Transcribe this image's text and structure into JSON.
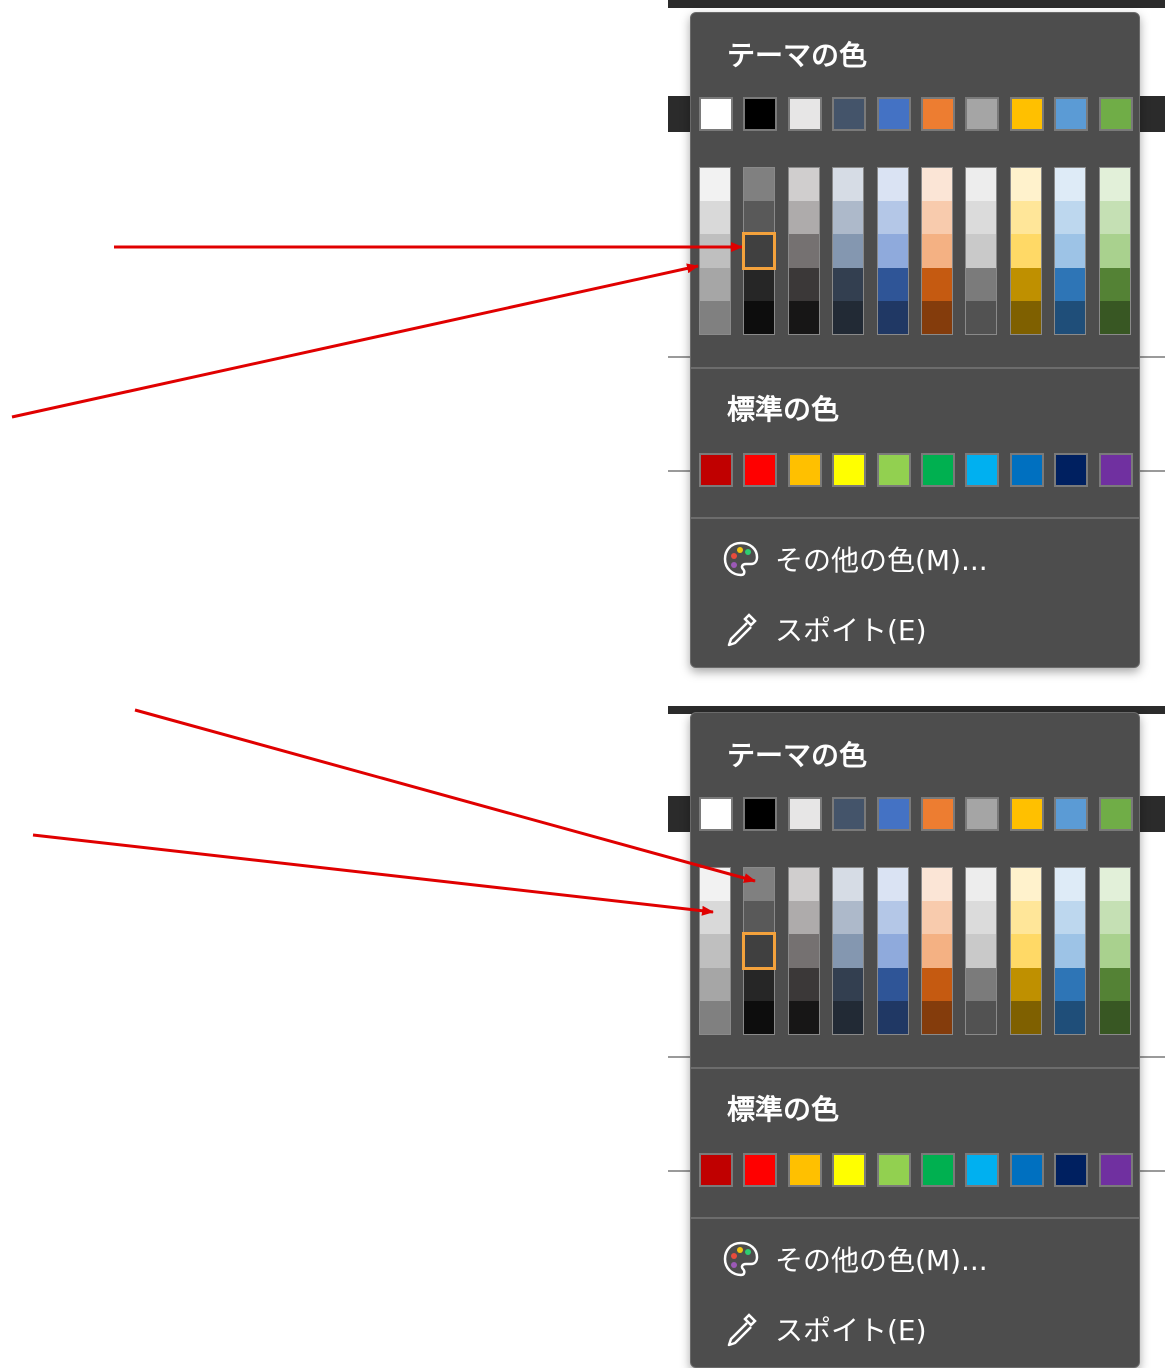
{
  "panels": [
    {
      "theme_heading": "テーマの色",
      "standard_heading": "標準の色",
      "more_colors_label": "その他の色(M)...",
      "eyedropper_label": "スポイト(E)"
    },
    {
      "theme_heading": "テーマの色",
      "standard_heading": "標準の色",
      "more_colors_label": "その他の色(M)...",
      "eyedropper_label": "スポイト(E)"
    }
  ],
  "theme_colors": [
    "#ffffff",
    "#000000",
    "#e7e6e6",
    "#44546a",
    "#4472c4",
    "#ed7d31",
    "#a5a5a5",
    "#ffc000",
    "#5b9bd5",
    "#70ad47"
  ],
  "theme_shades": [
    [
      "#f2f2f2",
      "#d9d9d9",
      "#bfbfbf",
      "#a6a6a6",
      "#808080"
    ],
    [
      "#808080",
      "#595959",
      "#404040",
      "#262626",
      "#0d0d0d"
    ],
    [
      "#d0cece",
      "#aeabab",
      "#757171",
      "#3b3838",
      "#171616"
    ],
    [
      "#d6dce5",
      "#adb9ca",
      "#8497b0",
      "#333f50",
      "#222a35"
    ],
    [
      "#dae3f3",
      "#b4c7e7",
      "#8faadc",
      "#2f5597",
      "#203864"
    ],
    [
      "#fbe5d6",
      "#f8cbad",
      "#f4b183",
      "#c55a11",
      "#843c0c"
    ],
    [
      "#ededed",
      "#dbdbdb",
      "#c9c9c9",
      "#7b7b7b",
      "#525252"
    ],
    [
      "#fff2cc",
      "#ffe699",
      "#ffd966",
      "#bf9000",
      "#7f6000"
    ],
    [
      "#deebf7",
      "#bdd7ee",
      "#9dc3e6",
      "#2e75b6",
      "#1f4e79"
    ],
    [
      "#e2f0d9",
      "#c5e0b4",
      "#a9d18e",
      "#548235",
      "#385723"
    ]
  ],
  "standard_colors": [
    "#c00000",
    "#ff0000",
    "#ffc000",
    "#ffff00",
    "#92d050",
    "#00b050",
    "#00b0f0",
    "#0070c0",
    "#002060",
    "#7030a0"
  ],
  "selected_shade": {
    "column": 1,
    "row": 2
  },
  "accent_colors": {
    "panel_bg": "#4d4d4d",
    "selection_outline": "#f4a23c",
    "annotation_arrow": "#e00000"
  },
  "icons": [
    "palette-icon",
    "eyedropper-icon"
  ]
}
